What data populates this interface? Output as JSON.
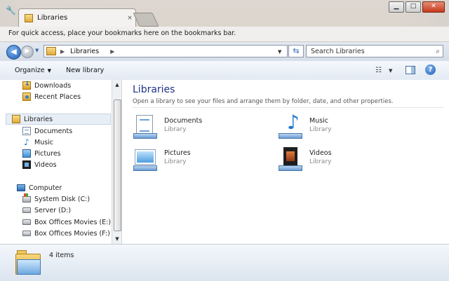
{
  "browser": {
    "tab_title": "Libraries",
    "tab_close": "×",
    "bookmarks_bar_text": "For quick access, place your bookmarks here on the bookmarks bar.",
    "window_buttons": {
      "minimize": "▁",
      "maximize": "□",
      "close": "✕"
    }
  },
  "addressbar": {
    "breadcrumb": "Libraries",
    "search_placeholder": "Search Libraries"
  },
  "commandbar": {
    "organize_label": "Organize",
    "new_library_label": "New library",
    "help": "?"
  },
  "navpane": {
    "favorites": [
      {
        "label": "Downloads",
        "icon": "downloads-icon"
      },
      {
        "label": "Recent Places",
        "icon": "recent-places-icon"
      }
    ],
    "libraries_label": "Libraries",
    "libraries": [
      {
        "label": "Documents",
        "icon": "documents-icon"
      },
      {
        "label": "Music",
        "icon": "music-icon"
      },
      {
        "label": "Pictures",
        "icon": "pictures-icon"
      },
      {
        "label": "Videos",
        "icon": "videos-icon"
      }
    ],
    "computer_label": "Computer",
    "drives": [
      {
        "label": "System Disk (C:)",
        "icon": "system-disk-icon"
      },
      {
        "label": "Server (D:)",
        "icon": "drive-icon"
      },
      {
        "label": "Box Offices Movies (E:)",
        "icon": "drive-icon"
      },
      {
        "label": "Box Offices Movies (F:)",
        "icon": "drive-icon"
      }
    ]
  },
  "content": {
    "title": "Libraries",
    "description": "Open a library to see your files and arrange them by folder, date, and other properties.",
    "items": [
      {
        "name": "Documents",
        "type": "Library",
        "icon": "documents-library-icon"
      },
      {
        "name": "Music",
        "type": "Library",
        "icon": "music-library-icon"
      },
      {
        "name": "Pictures",
        "type": "Library",
        "icon": "pictures-library-icon"
      },
      {
        "name": "Videos",
        "type": "Library",
        "icon": "videos-library-icon"
      }
    ]
  },
  "statusbar": {
    "item_count": "4 items"
  },
  "colors": {
    "title_blue": "#1e3287",
    "selection_bg": "#e8eef6",
    "folder_yellow": "#dfa534"
  }
}
